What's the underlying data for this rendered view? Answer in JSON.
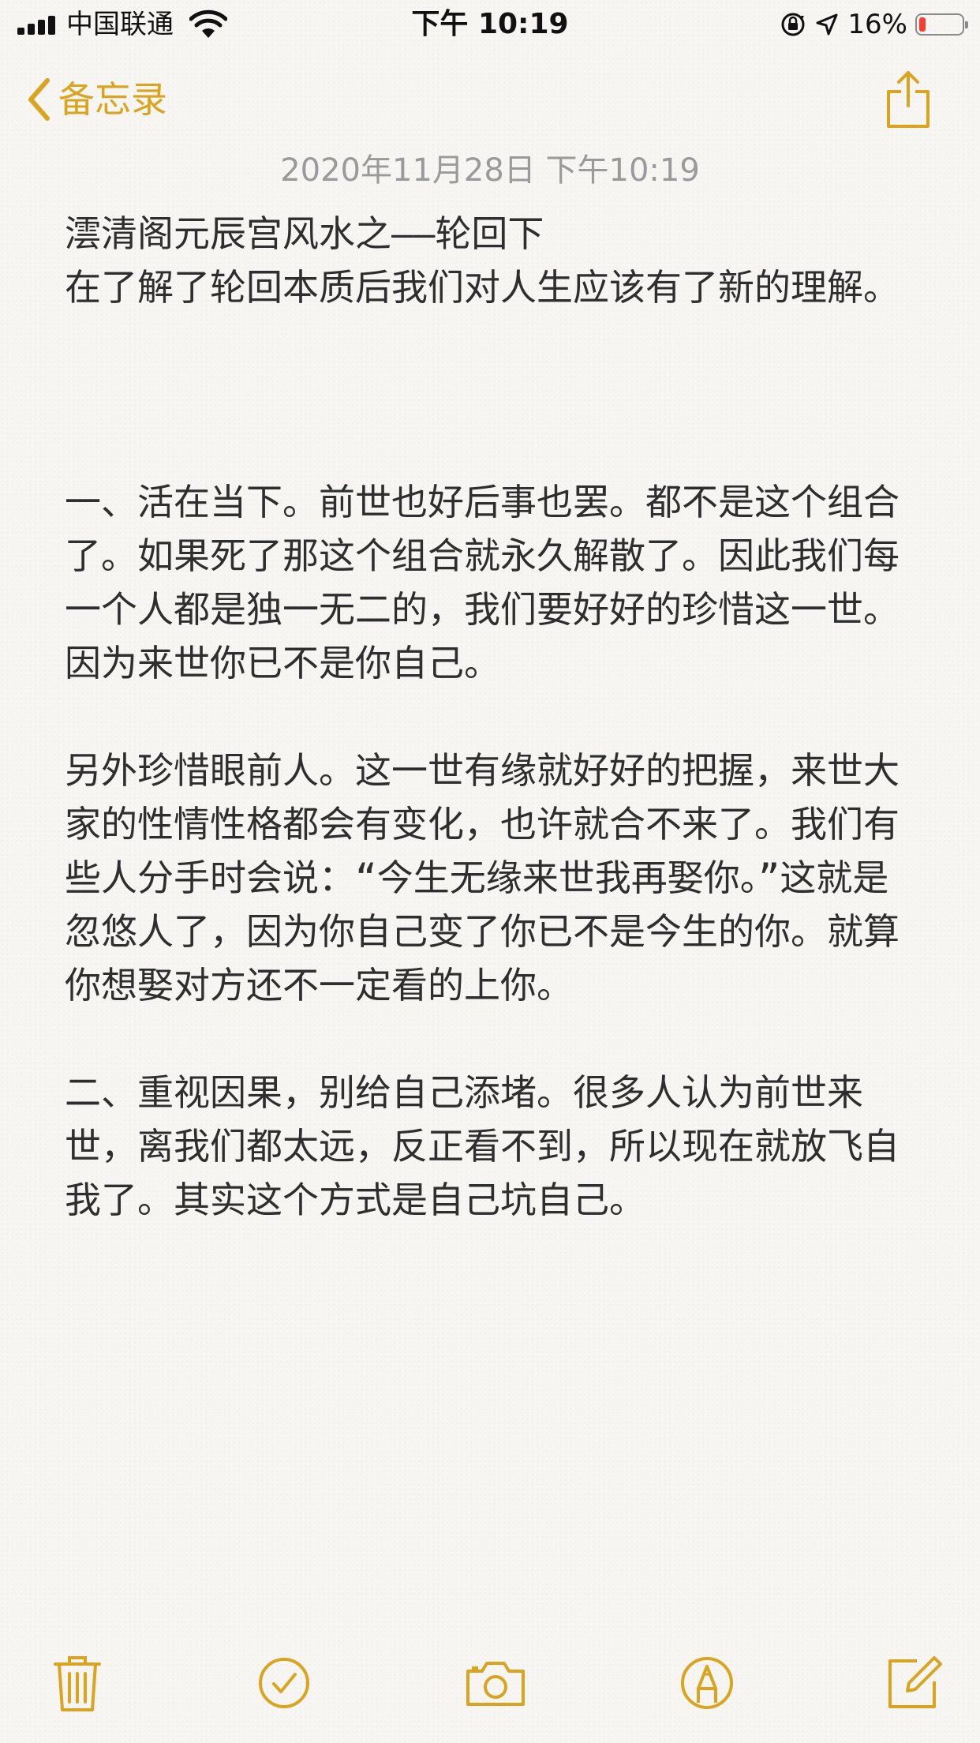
{
  "status_bar": {
    "carrier": "中国联通",
    "time": "下午 10:19",
    "battery_percent": "16%",
    "battery_level": 0.16,
    "icons": [
      "signal-icon",
      "wifi-icon",
      "orientation-lock-icon",
      "location-icon",
      "battery-icon"
    ]
  },
  "nav": {
    "back_label": "备忘录",
    "back_icon": "chevron-left-icon",
    "share_icon": "share-icon"
  },
  "note": {
    "date": "2020年11月28日 下午10:19",
    "body": "澐清阁元辰宫风水之——轮回下\n在了解了轮回本质后我们对人生应该有了新的理解。\n\n\n\n一、活在当下。前世也好后事也罢。都不是这个组合了。如果死了那这个组合就永久解散了。因此我们每一个人都是独一无二的，我们要好好的珍惜这一世。因为来世你已不是你自己。\n\n另外珍惜眼前人。这一世有缘就好好的把握，来世大家的性情性格都会有变化，也许就合不来了。我们有些人分手时会说：“今生无缘来世我再娶你。”这就是忽悠人了，因为你自己变了你已不是今生的你。就算你想娶对方还不一定看的上你。\n\n二、重视因果，别给自己添堵。很多人认为前世来世，离我们都太远，反正看不到，所以现在就放飞自我了。其实这个方式是自己坑自己。"
  },
  "toolbar": {
    "icons": [
      "trash-icon",
      "checklist-icon",
      "camera-icon",
      "markup-icon",
      "compose-icon"
    ]
  },
  "colors": {
    "accent": "#d9a520",
    "text": "#2e2e2e",
    "date": "#9a9a9a",
    "battery_low": "#ff3b30"
  }
}
